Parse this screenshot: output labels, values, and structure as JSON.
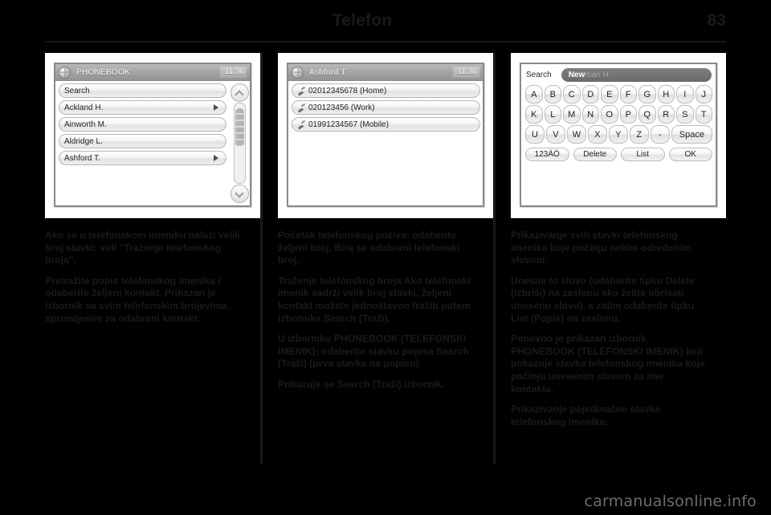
{
  "header": {
    "title": "Telefon",
    "page_number": "83"
  },
  "figures": [
    {
      "type": "list-screen",
      "titlebar": {
        "icon": "globe-icon",
        "title": "PHONEBOOK",
        "clock": "11:36"
      },
      "rows": [
        {
          "label": "Search",
          "arrow": false
        },
        {
          "label": "Ackland H.",
          "arrow": true
        },
        {
          "label": "Ainworth M.",
          "arrow": false
        },
        {
          "label": "Aldridge L.",
          "arrow": false
        },
        {
          "label": "Ashford T.",
          "arrow": true
        }
      ],
      "scrollbar": {
        "up": "chevron-up-icon",
        "down": "chevron-down-icon"
      }
    },
    {
      "type": "contact-screen",
      "titlebar": {
        "icon": "globe-icon",
        "title": "Ashford T.",
        "clock": "11:36"
      },
      "rows": [
        {
          "label": "02012345678 (Home)"
        },
        {
          "label": "020123456 (Work)"
        },
        {
          "label": "01991234567 (Mobile)"
        }
      ]
    },
    {
      "type": "keyboard-screen",
      "search_label": "Search",
      "search_typed": "New",
      "search_suggestion": "man H.",
      "keyrows": [
        [
          "A",
          "B",
          "C",
          "D",
          "E",
          "F",
          "G",
          "H",
          "I",
          "J"
        ],
        [
          "K",
          "L",
          "M",
          "N",
          "O",
          "P",
          "Q",
          "R",
          "S",
          "T"
        ],
        [
          "U",
          "V",
          "W",
          "X",
          "Y",
          "Z",
          "-",
          "Space"
        ]
      ],
      "function_keys": [
        "123ÄÖ",
        "Delete",
        "List",
        "OK"
      ]
    }
  ],
  "columns": [
    {
      "paragraphs": [
        "Ako se u telefonskom imeniku nalazi velik broj stavki: vidi \"Traženje telefonskog broja\".",
        "Pretražite popis telefonskog imenika i odaberite željeni kontakt. Prikazan je izbornik sa svim telefonskim brojevima spremljenim za odabrani kontakt."
      ]
    },
    {
      "paragraphs": [
        "Početak telefonskog poziva: odaberite željeni broj. Bira se odabrani telefonski broj.",
        "Traženje telefonskog broja Ako telefonski imenik sadrži velik broj stavki, željeni kontakt možete jednostavno tražiti putem izbornika Search (Traži).",
        "U izborniku PHONEBOOK (TELEFONSKI IMENIK): odaberite stavku popisa Search (Traži) (prva stavka na popisu).",
        "Prikazuje se Search (Traži) izbornik."
      ]
    },
    {
      "paragraphs": [
        "Prikazivanje svih stavki telefonskog imenika koje počinju nekim određenim slovom:",
        "Unesite to slovo (odaberite tipku Delete (Izbriši) na zaslonu ako želite obrisati uneseno slovo), a zatim odaberite tipku List (Popis) na zaslonu.",
        "Ponovno je prikazan izbornik PHONEBOOK (TELEFONSKI IMENIK) koji pokazuje stavke telefonskog imenika koje počinju unesenim slovom za ime kontakta.",
        "Prikazivanje pojedinačne stavke telefonskog imenika:"
      ]
    }
  ],
  "watermark": "carmanualsonline.info"
}
